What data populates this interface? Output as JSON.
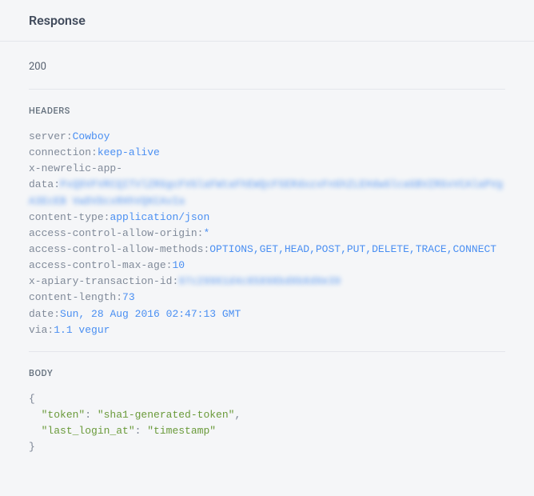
{
  "header": {
    "title": "Response"
  },
  "status": {
    "code": "200"
  },
  "sections": {
    "headers_label": "HEADERS",
    "body_label": "BODY"
  },
  "headers": {
    "server": {
      "key": "server",
      "value": "Cowboy"
    },
    "connection": {
      "key": "connection",
      "value": "keep-alive"
    },
    "x_newrelic_app_data": {
      "key1": "x-newrelic-app-",
      "key2": "data",
      "value": "PxQDVFVRCQITVlZRGgcFVGlaFWtaFhEWQcF5ERdozxFnGhZLEHdwGlcaGBVZRGvVCAlaPVgA3EcEB VwDVDcxRHhVQKCAvIa"
    },
    "content_type": {
      "key": "content-type",
      "value": "application/json"
    },
    "ac_allow_origin": {
      "key": "access-control-allow-origin",
      "value": "*"
    },
    "ac_allow_methods": {
      "key": "access-control-allow-methods",
      "value": "OPTIONS,GET,HEAD,POST,PUT,DELETE,TRACE,CONNECT"
    },
    "ac_max_age": {
      "key": "access-control-max-age",
      "value": "10"
    },
    "x_apiary_txn": {
      "key": "x-apiary-transaction-id",
      "value": "97c29961d4c85898bd0b8d0e39"
    },
    "content_length": {
      "key": "content-length",
      "value": "73"
    },
    "date": {
      "key": "date",
      "value": "Sun, 28 Aug 2016 02:47:13 GMT"
    },
    "via": {
      "key": "via",
      "value": "1.1 vegur"
    }
  },
  "body_json": {
    "token_key": "\"token\"",
    "token_val": "\"sha1-generated-token\"",
    "last_login_key": "\"last_login_at\"",
    "last_login_val": "\"timestamp\""
  }
}
